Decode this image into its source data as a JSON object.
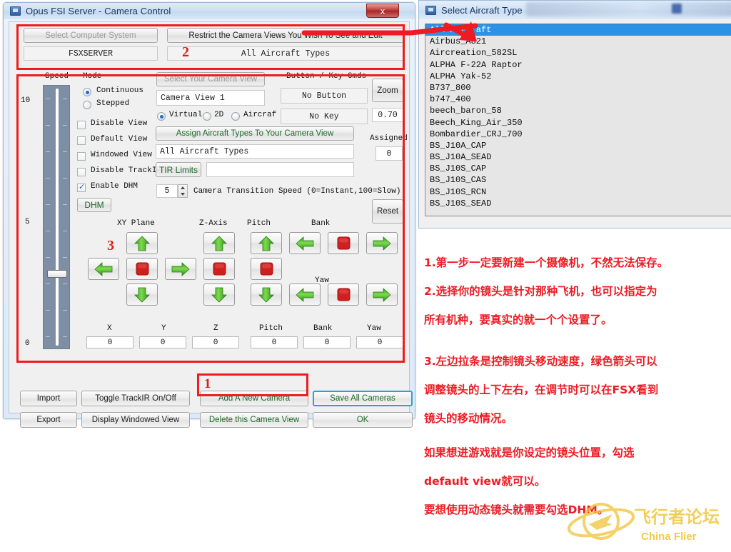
{
  "window_opus": {
    "title": "Opus FSI Server - Camera Control",
    "close_label": "x",
    "top": {
      "select_computer_system": "Select Computer System",
      "computer_value": "FSXSERVER",
      "restrict_views": "Restrict the Camera Views You Wish To See and Edit",
      "aircraft_types_value": "All Aircraft Types"
    },
    "speed": {
      "label": "Speed",
      "tick_top": "10",
      "tick_mid": "5",
      "tick_bottom": "0",
      "value": 3.3
    },
    "mode": {
      "label": "Mode",
      "options": [
        {
          "label": "Continuous",
          "selected": true
        },
        {
          "label": "Stepped",
          "selected": false
        }
      ]
    },
    "checkboxes": [
      {
        "label": "Disable View",
        "checked": false
      },
      {
        "label": "Default View",
        "checked": false
      },
      {
        "label": "Windowed View",
        "checked": false
      },
      {
        "label": "Disable TrackIR",
        "checked": false
      },
      {
        "label": "Enable DHM",
        "checked": true
      }
    ],
    "dhm_button": "DHM",
    "camera": {
      "select_view_label": "Select Your Camera View",
      "view_name": "Camera View 1",
      "view_types": [
        {
          "label": "Virtual",
          "selected": true
        },
        {
          "label": "2D",
          "selected": false
        },
        {
          "label": "Aircraf",
          "selected": false
        }
      ],
      "assign_button": "Assign Aircraft Types To Your Camera View",
      "assigned_value": "All Aircraft Types",
      "tir_limits_button": "TIR Limits",
      "tir_limits_value": "",
      "transition_speed": "5",
      "transition_label": "Camera Transition Speed  (0=Instant,100=Slow)"
    },
    "cmds": {
      "header": "Button / Key Cmds",
      "no_button": "No Button",
      "no_key": "No Key",
      "zoom_button": "Zoom",
      "zoom_value": "0.70",
      "assigned_label": "Assigned",
      "assigned_count": "0"
    },
    "reset_button": "Reset",
    "axis_groups": [
      {
        "name": "XY Plane"
      },
      {
        "name": "Z-Axis"
      },
      {
        "name": "Pitch"
      },
      {
        "name": "Bank"
      },
      {
        "name": "Yaw"
      }
    ],
    "values": [
      {
        "label": "X",
        "value": "0"
      },
      {
        "label": "Y",
        "value": "0"
      },
      {
        "label": "Z",
        "value": "0"
      },
      {
        "label": "Pitch",
        "value": "0"
      },
      {
        "label": "Bank",
        "value": "0"
      },
      {
        "label": "Yaw",
        "value": "0"
      }
    ],
    "bottom_buttons": {
      "import": "Import",
      "export": "Export",
      "toggle_trackir": "Toggle TrackIR On/Off",
      "display_windowed": "Display Windowed View",
      "add_camera": "Add A New Camera",
      "delete_camera": "Delete this Camera View",
      "save_all": "Save All Cameras",
      "ok": "OK"
    }
  },
  "window_aircraft": {
    "title": "Select Aircraft Type",
    "items": [
      {
        "label": "All Aircraft",
        "selected": true
      },
      {
        "label": "Airbus_A321",
        "selected": false
      },
      {
        "label": "Aircreation_582SL",
        "selected": false
      },
      {
        "label": "ALPHA F-22A Raptor",
        "selected": false
      },
      {
        "label": "ALPHA Yak-52",
        "selected": false
      },
      {
        "label": "B737_800",
        "selected": false
      },
      {
        "label": "b747_400",
        "selected": false
      },
      {
        "label": "beech_baron_58",
        "selected": false
      },
      {
        "label": "Beech_King_Air_350",
        "selected": false
      },
      {
        "label": "Bombardier_CRJ_700",
        "selected": false
      },
      {
        "label": "BS_J10A_CAP",
        "selected": false
      },
      {
        "label": "BS_J10A_SEAD",
        "selected": false
      },
      {
        "label": "BS_J10S_CAP",
        "selected": false
      },
      {
        "label": "BS_J10S_CAS",
        "selected": false
      },
      {
        "label": "BS_J10S_RCN",
        "selected": false
      },
      {
        "label": "BS_J10S_SEAD",
        "selected": false
      }
    ]
  },
  "annotations": {
    "marker_1": "1",
    "marker_2": "2",
    "marker_3": "3",
    "notes": [
      "1.第一步一定要新建一个摄像机，不然无法保存。",
      "2.选择你的镜头是针对那种飞机，也可以指定为",
      "所有机种，要真实的就一个个设置了。",
      "3.左边拉条是控制镜头移动速度，绿色箭头可以",
      "调整镜头的上下左右，在调节时可以在FSX看到",
      "镜头的移动情况。",
      "如果想进游戏就是你设定的镜头位置，勾选",
      "default view就可以。",
      "要想使用动态镜头就需要勾选DHM。"
    ],
    "accent_red": "#ee1b24"
  },
  "watermark": {
    "cn": "飞行者论坛",
    "en": "China Flier",
    "color": "#f0c230"
  }
}
